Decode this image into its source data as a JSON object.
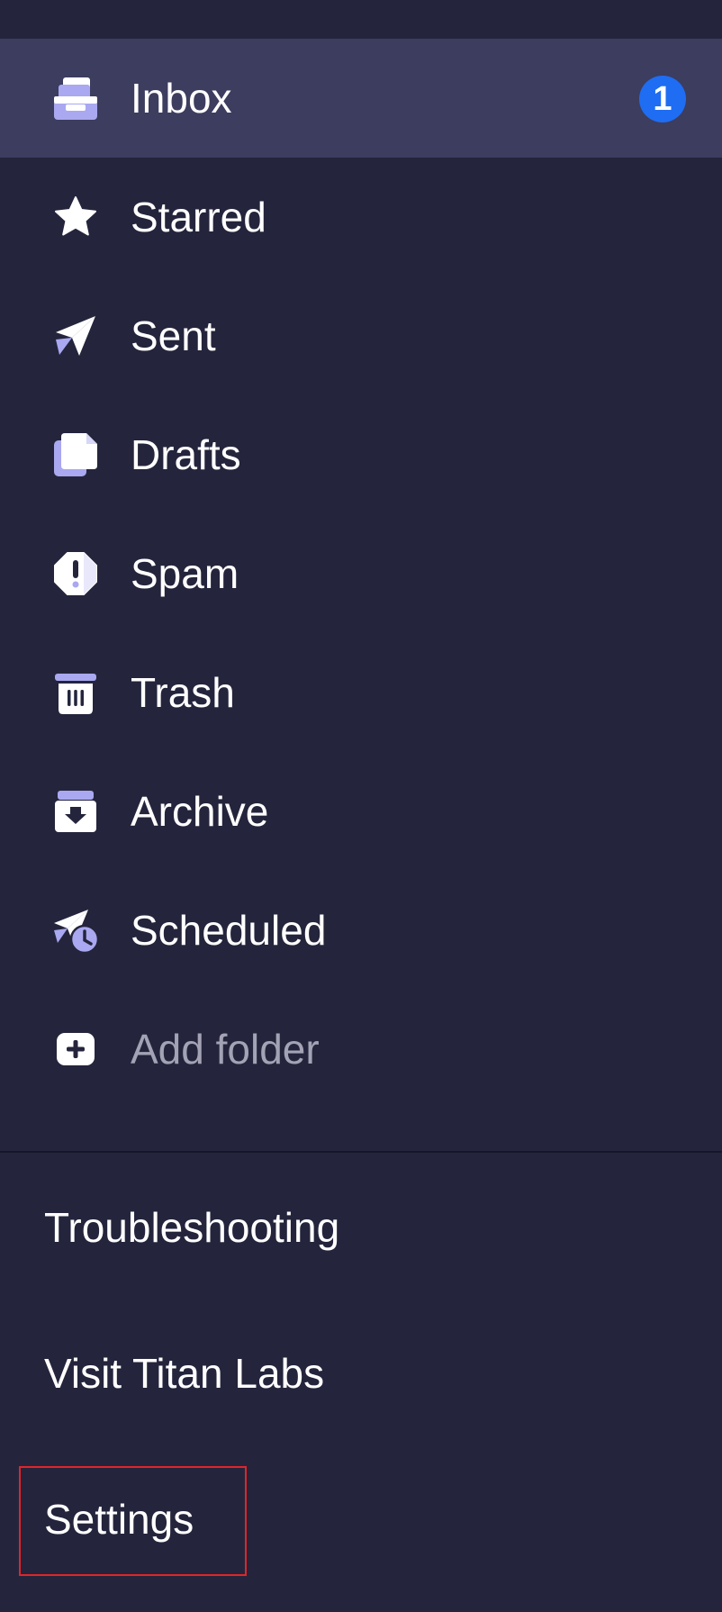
{
  "colors": {
    "background": "#24253c",
    "selected_row": "#3c3d5f",
    "badge": "#1f6df2",
    "icon_accent": "#a9a8f0",
    "highlight_border": "#e0252b"
  },
  "folders": [
    {
      "label": "Inbox",
      "icon": "inbox-icon",
      "badge": "1"
    },
    {
      "label": "Starred",
      "icon": "star-icon"
    },
    {
      "label": "Sent",
      "icon": "paper-plane-icon"
    },
    {
      "label": "Drafts",
      "icon": "drafts-icon"
    },
    {
      "label": "Spam",
      "icon": "spam-icon"
    },
    {
      "label": "Trash",
      "icon": "trash-icon"
    },
    {
      "label": "Archive",
      "icon": "archive-icon"
    },
    {
      "label": "Scheduled",
      "icon": "scheduled-send-icon"
    },
    {
      "label": "Add folder",
      "icon": "add-folder-icon"
    }
  ],
  "links": {
    "troubleshooting": "Troubleshooting",
    "visit_titan_labs": "Visit Titan Labs",
    "settings": "Settings"
  }
}
